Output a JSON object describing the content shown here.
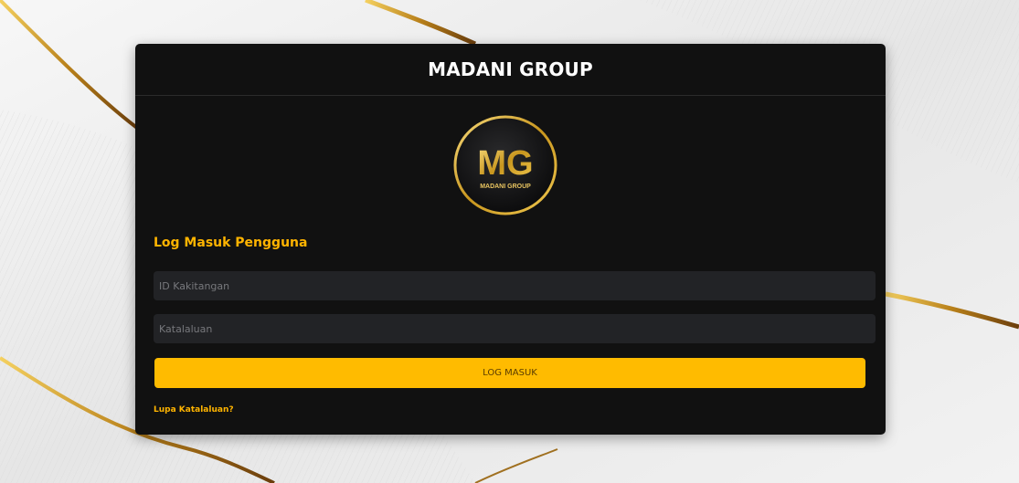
{
  "card": {
    "title": "MADANI GROUP"
  },
  "logo": {
    "monogram": "MG",
    "wordmark": "MADANI GROUP"
  },
  "login": {
    "section_title": "Log Masuk Pengguna",
    "staff_id": {
      "placeholder": "ID Kakitangan",
      "value": ""
    },
    "password": {
      "placeholder": "Katalaluan",
      "value": ""
    },
    "submit_label": "LOG MASUK",
    "forgot_link": "Lupa Katalaluan?"
  },
  "colors": {
    "accent": "#ffbb00",
    "card_bg": "#111111",
    "field_bg": "#222326",
    "gold_ribbon": "#c8961e",
    "page_bg": "#eeeeee"
  }
}
